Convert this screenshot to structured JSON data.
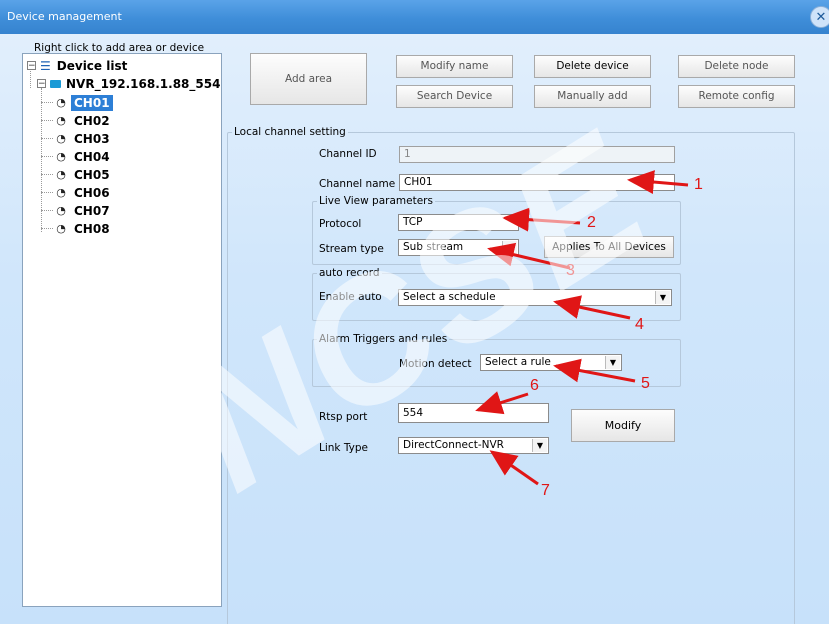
{
  "window": {
    "title": "Device management",
    "close_icon": "close-icon"
  },
  "tree": {
    "hint": "Right click to add area or device",
    "root_label": "Device list",
    "device_label": "NVR_192.168.1.88_554",
    "channels": [
      "CH01",
      "CH02",
      "CH03",
      "CH04",
      "CH05",
      "CH06",
      "CH07",
      "CH08"
    ],
    "selected_channel": "CH01",
    "icons": {
      "list": "list-icon",
      "device": "nvr-device-icon",
      "camera": "camera-icon"
    }
  },
  "toolbar": {
    "add_area": "Add area",
    "modify_name": "Modify name",
    "delete_device": "Delete device",
    "delete_node": "Delete node",
    "search_device": "Search Device",
    "manually_add": "Manually add",
    "remote_config": "Remote config"
  },
  "local_channel": {
    "title": "Local channel setting",
    "channel_id_label": "Channel ID",
    "channel_id_value": "1",
    "channel_name_label": "Channel name",
    "channel_name_value": "CH01",
    "live_view": {
      "title": "Live View parameters",
      "protocol_label": "Protocol",
      "protocol_value": "TCP",
      "stream_type_label": "Stream type",
      "stream_type_value": "Sub stream",
      "apply_all": "Applies To All Devices"
    },
    "auto_record": {
      "title": "auto record",
      "enable_label": "Enable auto",
      "schedule_value": "Select a schedule"
    },
    "alarm": {
      "title": "Alarm Triggers and rules",
      "motion_label": "Motion detect",
      "rule_value": "Select a rule"
    },
    "rtsp_label": "Rtsp port",
    "rtsp_value": "554",
    "link_type_label": "Link Type",
    "link_type_value": "DirectConnect-NVR",
    "modify_button": "Modify"
  },
  "annotations": [
    "1",
    "2",
    "3",
    "4",
    "5",
    "6",
    "7"
  ],
  "watermark": "NCSE",
  "colors": {
    "titlebar": "#3f8ed9",
    "selection": "#2d7fd6",
    "annotation": "#e01616"
  }
}
